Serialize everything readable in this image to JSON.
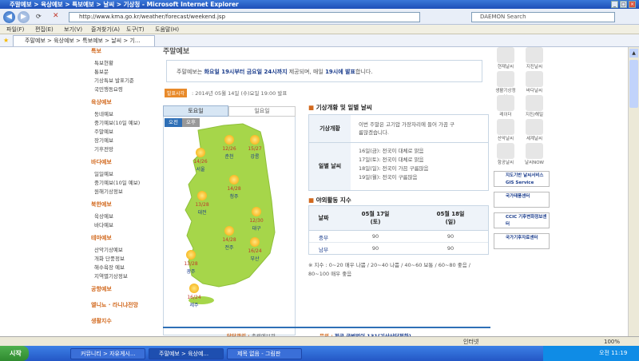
{
  "window": {
    "title": "주말예보 > 육상예보 > 특보예보 > 날씨 > 기상청 - Microsoft Internet Explorer"
  },
  "address": {
    "url": "http://www.kma.go.kr/weather/forecast/weekend.jsp",
    "search_placeholder": "DAEMON Search"
  },
  "menu": [
    "파일(F)",
    "편집(E)",
    "보기(V)",
    "즐겨찾기(A)",
    "도구(T)",
    "도움말(H)"
  ],
  "tab": {
    "label": "주말예보 > 육상예보 > 특보예보 > 날씨 > 기..."
  },
  "left_nav": {
    "sections": [
      {
        "title": "특보",
        "items": [
          "특보현황",
          "통보문",
          "기상특보 발표기준",
          "국민행동요령"
        ]
      },
      {
        "title": "육상예보",
        "items": [
          "동네예보",
          "중기예보(10일 예보)",
          "주말예보",
          "장기예보",
          "기후전망"
        ]
      },
      {
        "title": "바다예보",
        "items": [
          "일일예보",
          "중기예보(10일 예보)",
          "원해기상정보"
        ]
      },
      {
        "title": "북한예보",
        "items": [
          "육상예보",
          "바다예보"
        ]
      },
      {
        "title": "테마예보",
        "items": [
          "산악기상예보",
          "개화 단풍정보",
          "해수욕장 예보",
          "지역별기상정보"
        ]
      },
      {
        "title": "공항예보",
        "items": []
      },
      {
        "title": "엘니뇨 · 라니냐전망",
        "items": []
      },
      {
        "title": "생활지수",
        "items": []
      }
    ]
  },
  "page": {
    "heading": "주말예보",
    "notice_parts": [
      "주말예보는 ",
      "화요일 19시부터 금요일 24시까지",
      " 제공되며, 매일 ",
      "19시에 발표",
      "합니다."
    ],
    "announce_badge": "발표시각",
    "announce_time": ": 2014년 05월 14일 (수)요일 19:00 발표",
    "day_tabs": [
      "토요일",
      "일요일"
    ],
    "ampm": [
      "오전",
      "오후"
    ],
    "cities": [
      {
        "name": "서울",
        "temp": "14/26"
      },
      {
        "name": "춘천",
        "temp": "12/26"
      },
      {
        "name": "강릉",
        "temp": "15/27"
      },
      {
        "name": "청주",
        "temp": "14/28"
      },
      {
        "name": "대전",
        "temp": "13/28"
      },
      {
        "name": "대구",
        "temp": "12/30"
      },
      {
        "name": "전주",
        "temp": "14/28"
      },
      {
        "name": "광주",
        "temp": "13/28"
      },
      {
        "name": "부산",
        "temp": "16/24"
      },
      {
        "name": "제주",
        "temp": "16/24"
      }
    ],
    "outlook_title": "기상개황 및 일별 날씨",
    "outlook": [
      {
        "label": "기상개황",
        "lines": [
          "이번 주말은 고기압 가장자리에 들어 가끔 구",
          "름많겠습니다."
        ]
      },
      {
        "label": "일별 날씨",
        "lines": [
          "16일(금): 전국이 대체로 맑음",
          "17일(토): 전국이 대체로 맑음",
          "18일(일): 전국이 가끔 구름많음",
          "19일(월): 전국이 구름많음"
        ]
      }
    ],
    "outdoor_title": "야외활동 지수",
    "outdoor_headers": [
      "날짜",
      "05월 17일\n(토)",
      "05월 18일\n(일)"
    ],
    "outdoor_rows": [
      [
        "중부",
        "90",
        "90"
      ],
      [
        "남부",
        "90",
        "90"
      ]
    ],
    "index_note": [
      "※ 지수 : 0~20 매우 나쁨 / 20~40 나쁨 / 40~60 보통 / 60~80 좋음 /",
      "80~100 매우 좋음"
    ],
    "footer_manager_label": "담당관리 :",
    "footer_manager": "총괄예보관",
    "footer_contact_label": "문의 :",
    "footer_contact": "전국 국번없이 131(기상상담전화)"
  },
  "right_icons": [
    [
      "현재날씨",
      "지진날씨"
    ],
    [
      "생활기상정보",
      "바다날씨"
    ],
    [
      "레이더",
      "지진/해일"
    ],
    [
      "산악날씨",
      "세계날씨"
    ],
    [
      "항공날씨",
      "날씨NOW"
    ]
  ],
  "right_banners": [
    "지도기반 날씨서비스 GIS Service",
    "국가태풍센터",
    "CCIC 기후변화정보센터",
    "국가기후자료센터"
  ],
  "statusbar": {
    "zone": "인터넷",
    "zoom": "100%"
  },
  "taskbar": {
    "start": "시작",
    "tasks": [
      "커뮤니티 > 자유게시...",
      "주말예보 > 육상예...",
      "제목 없음 - 그림판"
    ],
    "clock": "오전 11:19"
  }
}
